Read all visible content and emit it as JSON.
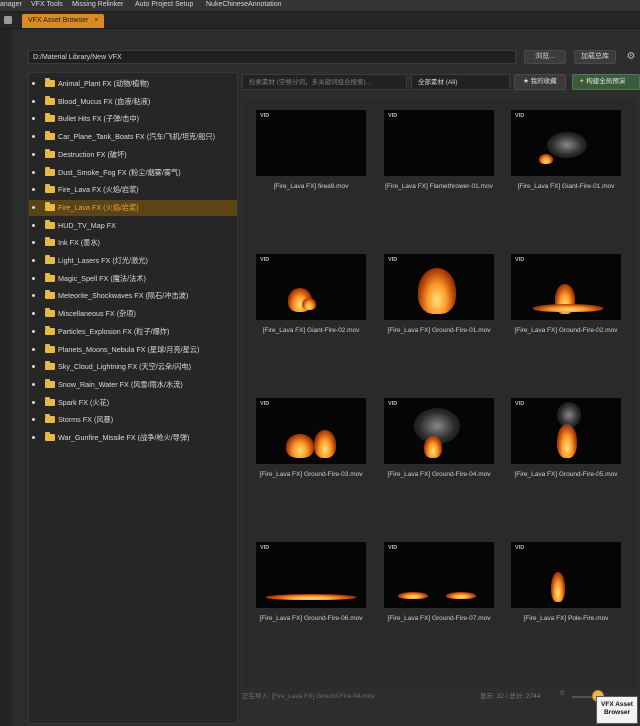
{
  "menubar": {
    "items": [
      "anager",
      "VFX Tools",
      "Missing Relinker",
      "Auto Project Setup",
      "NukeChineseAnnotation"
    ]
  },
  "tab": {
    "title": "VFX Asset Browser",
    "close": "×"
  },
  "toolbar": {
    "path": "D:/Material Library/New VFX",
    "browse_label": "浏览...",
    "load_label": "加载总库",
    "settings_icon": "gear-icon"
  },
  "tree": {
    "selected_index": 7,
    "items": [
      {
        "label": "Animal_Plant FX (动物/植物)"
      },
      {
        "label": "Blood_Mucus FX (血液/粘液)"
      },
      {
        "label": "Bullet Hits FX (子弹/击中)"
      },
      {
        "label": "Car_Plane_Tank_Boats FX (汽车/飞机/坦克/船只)"
      },
      {
        "label": "Destruction FX (破坏)"
      },
      {
        "label": "Dust_Smoke_Fog FX (粉尘/烟雾/雾气)"
      },
      {
        "label": "Fire_Lava FX (火焰/岩浆)"
      },
      {
        "label": "Fire_Lava FX (火焰/岩浆)"
      },
      {
        "label": "HUD_TV_Map FX"
      },
      {
        "label": "Ink FX (墨水)"
      },
      {
        "label": "Light_Lasers FX (灯光/激光)"
      },
      {
        "label": "Magic_Spell FX (魔法/法术)"
      },
      {
        "label": "Meteorite_Shockwaves FX (陨石/冲击波)"
      },
      {
        "label": "Miscellaneous FX (杂项)"
      },
      {
        "label": "Particles_Explosion FX (粒子/爆炸)"
      },
      {
        "label": "Planets_Moons_Nebula FX (星球/月亮/星云)"
      },
      {
        "label": "Sky_Cloud_Lightning FX (天空/云朵/闪电)"
      },
      {
        "label": "Snow_Rain_Water FX (风雪/雨水/水流)"
      },
      {
        "label": "Spark FX (火花)"
      },
      {
        "label": "Storms FX (风暴)"
      },
      {
        "label": "War_Gunfire_Missile FX (战争/枪火/导弹)"
      }
    ]
  },
  "search": {
    "placeholder": "检索素材 (空格分词，多关键词组合搜索)...",
    "filter_value": "全部素材 (All)",
    "favorites_label": "★ 我的收藏",
    "build_label": "构建全局预演"
  },
  "cards": [
    {
      "badge": "VID",
      "caption": "[Fire_Lava FX] firea9.mov"
    },
    {
      "badge": "VID",
      "caption": "[Fire_Lava FX] Flamethrower-01.mov"
    },
    {
      "badge": "VID",
      "caption": "[Fire_Lava FX] Giant-Fire-01.mov"
    },
    {
      "badge": "VID",
      "caption": "[Fire_Lava FX] Giant-Fire-02.mov"
    },
    {
      "badge": "VID",
      "caption": "[Fire_Lava FX] Ground-Fire-01.mov"
    },
    {
      "badge": "VID",
      "caption": "[Fire_Lava FX] Ground-Fire-02.mov"
    },
    {
      "badge": "VID",
      "caption": "[Fire_Lava FX] Ground-Fire-03.mov"
    },
    {
      "badge": "VID",
      "caption": "[Fire_Lava FX] Ground-Fire-04.mov"
    },
    {
      "badge": "VID",
      "caption": "[Fire_Lava FX] Ground-Fire-05.mov"
    },
    {
      "badge": "VID",
      "caption": "[Fire_Lava FX] Ground-Fire-06.mov"
    },
    {
      "badge": "VID",
      "caption": "[Fire_Lava FX] Ground-Fire-07.mov"
    },
    {
      "badge": "VID",
      "caption": "[Fire_Lava FX] Pole-Fire.mov"
    }
  ],
  "statusbar": {
    "status": "正在导入: [Fire_Lava FX] Ground-Fire-04.mov",
    "count": "显示: 32 / 总计: 2744",
    "slider_label": "S"
  },
  "tooltip": {
    "line1": "VFX Asset",
    "line2": "Browser"
  },
  "colors": {
    "accent": "#d98a22",
    "selected_row": "#5b4416",
    "folder": "#e7b94a",
    "build_button": "#3c5a3c"
  }
}
